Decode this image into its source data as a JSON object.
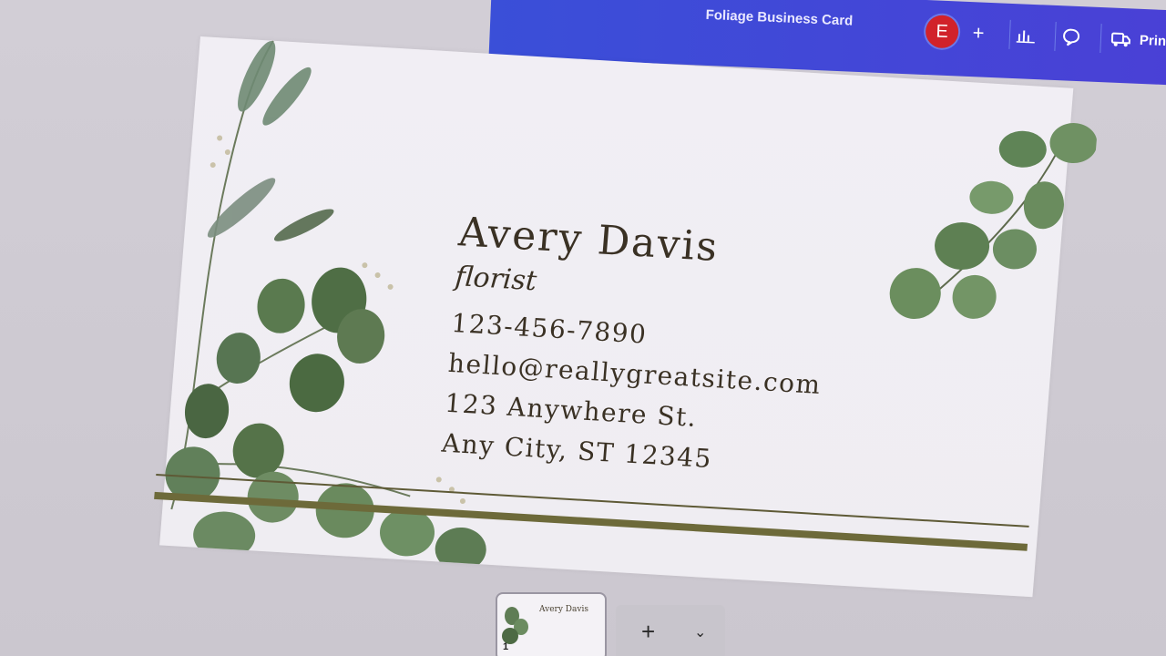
{
  "toolbar": {
    "doc_title": "Foliage Business Card",
    "avatar_letter": "E",
    "add_icon": "plus-icon",
    "insights_icon": "bar-chart-icon",
    "comments_icon": "comment-icon",
    "print_icon": "truck-icon",
    "print_label": "Prin",
    "bar_color": "#3a4fd8",
    "avatar_color": "#d1222a"
  },
  "card": {
    "name": "Avery Davis",
    "role": "florist",
    "phone": "123-456-7890",
    "email": "hello@reallygreatsite.com",
    "address_line1": "123 Anywhere St.",
    "address_line2": "Any City, ST 12345",
    "text_color": "#3a3124",
    "accent_color": "#6d6a3a"
  },
  "page_strip": {
    "thumb_name": "Avery Davis",
    "page_number": "1",
    "add_page_icon": "plus-icon",
    "more_icon": "chevron-down-icon"
  }
}
